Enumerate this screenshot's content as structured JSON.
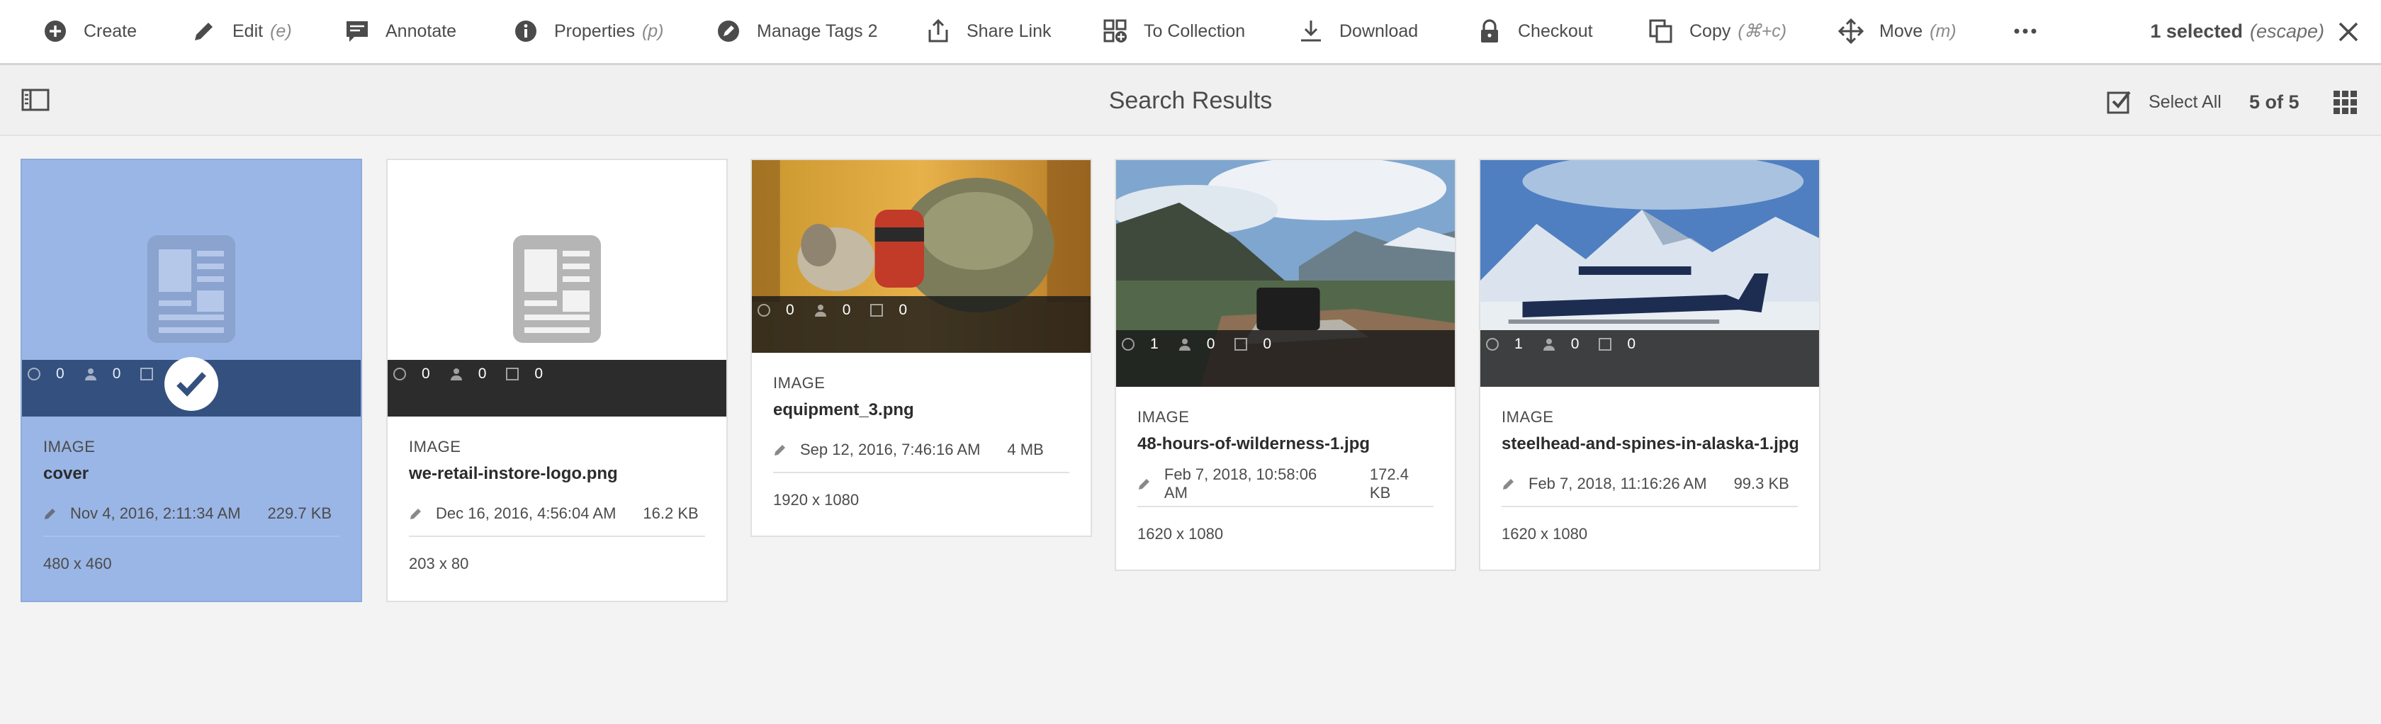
{
  "actionbar": {
    "actions": [
      {
        "label": "Create",
        "shortcut": "",
        "icon": "add-circle-icon"
      },
      {
        "label": "Edit",
        "shortcut": "(e)",
        "icon": "pencil-icon"
      },
      {
        "label": "Annotate",
        "shortcut": "",
        "icon": "comment-icon"
      },
      {
        "label": "Properties",
        "shortcut": "(p)",
        "icon": "info-icon"
      },
      {
        "label": "Manage Tags 2",
        "shortcut": "",
        "icon": "tag-icon"
      },
      {
        "label": "Share Link",
        "shortcut": "",
        "icon": "share-icon"
      },
      {
        "label": "To Collection",
        "shortcut": "",
        "icon": "collection-add-icon"
      },
      {
        "label": "Download",
        "shortcut": "",
        "icon": "download-icon"
      },
      {
        "label": "Checkout",
        "shortcut": "",
        "icon": "lock-icon"
      },
      {
        "label": "Copy",
        "shortcut": "(⌘+c)",
        "icon": "copy-icon"
      },
      {
        "label": "Move",
        "shortcut": "(m)",
        "icon": "move-icon"
      }
    ],
    "more_icon": "more-icon",
    "selection": {
      "count_text": "1 selected",
      "hint": "(escape)"
    }
  },
  "titlebar": {
    "title": "Search Results",
    "select_all": "Select All",
    "count": "5 of 5"
  },
  "colors": {
    "selected_card": "#9ab6e6",
    "selected_statbar": "#34507f",
    "statbar": "#2c2c2c"
  },
  "cards": [
    {
      "type": "IMAGE",
      "name": "cover",
      "modified": "Nov 4, 2016, 2:11:34 AM",
      "size": "229.7 KB",
      "dims": "480 x 460",
      "stats": [
        "0",
        "0",
        ""
      ],
      "selected": true
    },
    {
      "type": "IMAGE",
      "name": "we-retail-instore-logo.png",
      "modified": "Dec 16, 2016, 4:56:04 AM",
      "size": "16.2 KB",
      "dims": "203 x 80",
      "stats": [
        "0",
        "0",
        "0"
      ],
      "selected": false
    },
    {
      "type": "IMAGE",
      "name": "equipment_3.png",
      "modified": "Sep 12, 2016, 7:46:16 AM",
      "size": "4 MB",
      "dims": "1920 x 1080",
      "stats": [
        "0",
        "0",
        "0"
      ],
      "selected": false
    },
    {
      "type": "IMAGE",
      "name": "48-hours-of-wilderness-1.jpg",
      "modified": "Feb 7, 2018, 10:58:06 AM",
      "size": "172.4 KB",
      "dims": "1620 x 1080",
      "stats": [
        "1",
        "0",
        "0"
      ],
      "selected": false
    },
    {
      "type": "IMAGE",
      "name": "steelhead-and-spines-in-alaska-1.jpg",
      "modified": "Feb 7, 2018, 11:16:26 AM",
      "size": "99.3 KB",
      "dims": "1620 x 1080",
      "stats": [
        "1",
        "0",
        "0"
      ],
      "selected": false
    }
  ]
}
